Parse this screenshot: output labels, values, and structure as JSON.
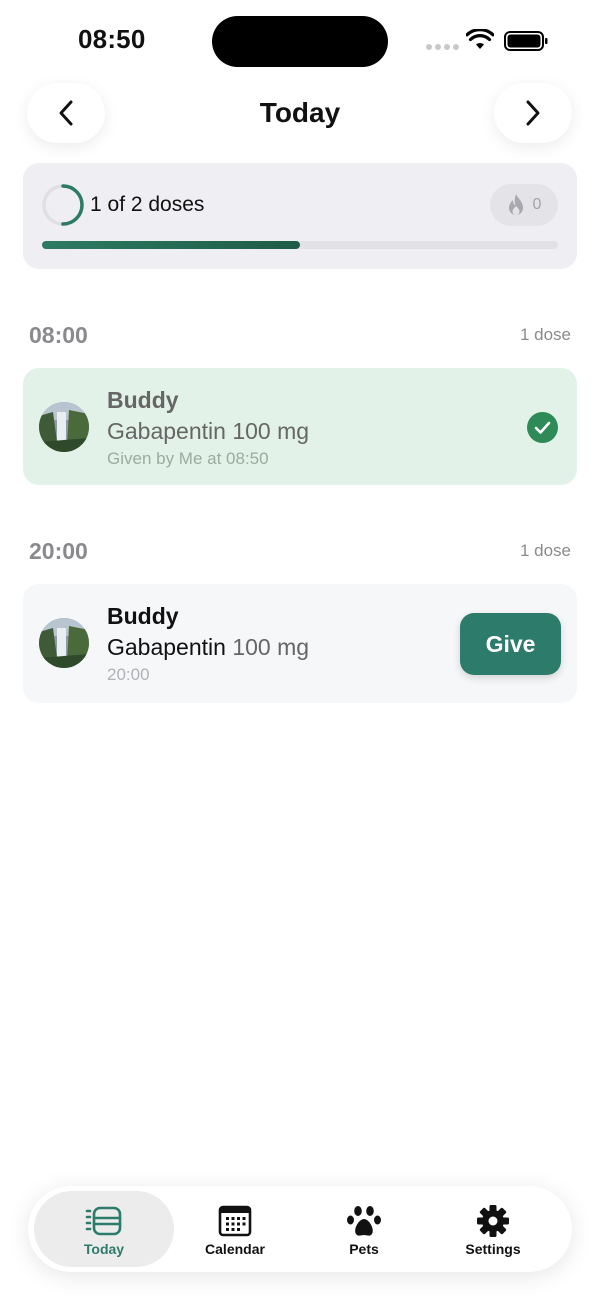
{
  "status_bar": {
    "time": "08:50"
  },
  "header": {
    "title": "Today",
    "prev_icon": "chevron-left-icon",
    "next_icon": "chevron-right-icon"
  },
  "progress": {
    "text": "1 of 2 doses",
    "completed": 1,
    "total": 2,
    "fraction": 0.5,
    "streak_icon": "flame-icon",
    "streak_count": "0",
    "accent_color": "#2d7b62"
  },
  "groups": [
    {
      "time": "08:00",
      "count_label": "1 dose",
      "dose": {
        "pet_name": "Buddy",
        "medication": "Gabapentin",
        "amount": "100 mg",
        "subtitle": "Given by Me at 08:50",
        "status": "given",
        "status_color": "#2e8b57"
      }
    },
    {
      "time": "20:00",
      "count_label": "1 dose",
      "dose": {
        "pet_name": "Buddy",
        "medication": "Gabapentin",
        "amount": "100 mg",
        "subtitle": "20:00",
        "status": "pending",
        "action_label": "Give",
        "action_color": "#2d7b6a"
      }
    }
  ],
  "tabs": [
    {
      "label": "Today",
      "icon": "today-list-icon",
      "selected": true
    },
    {
      "label": "Calendar",
      "icon": "calendar-icon",
      "selected": false
    },
    {
      "label": "Pets",
      "icon": "paw-icon",
      "selected": false
    },
    {
      "label": "Settings",
      "icon": "gear-icon",
      "selected": false
    }
  ]
}
